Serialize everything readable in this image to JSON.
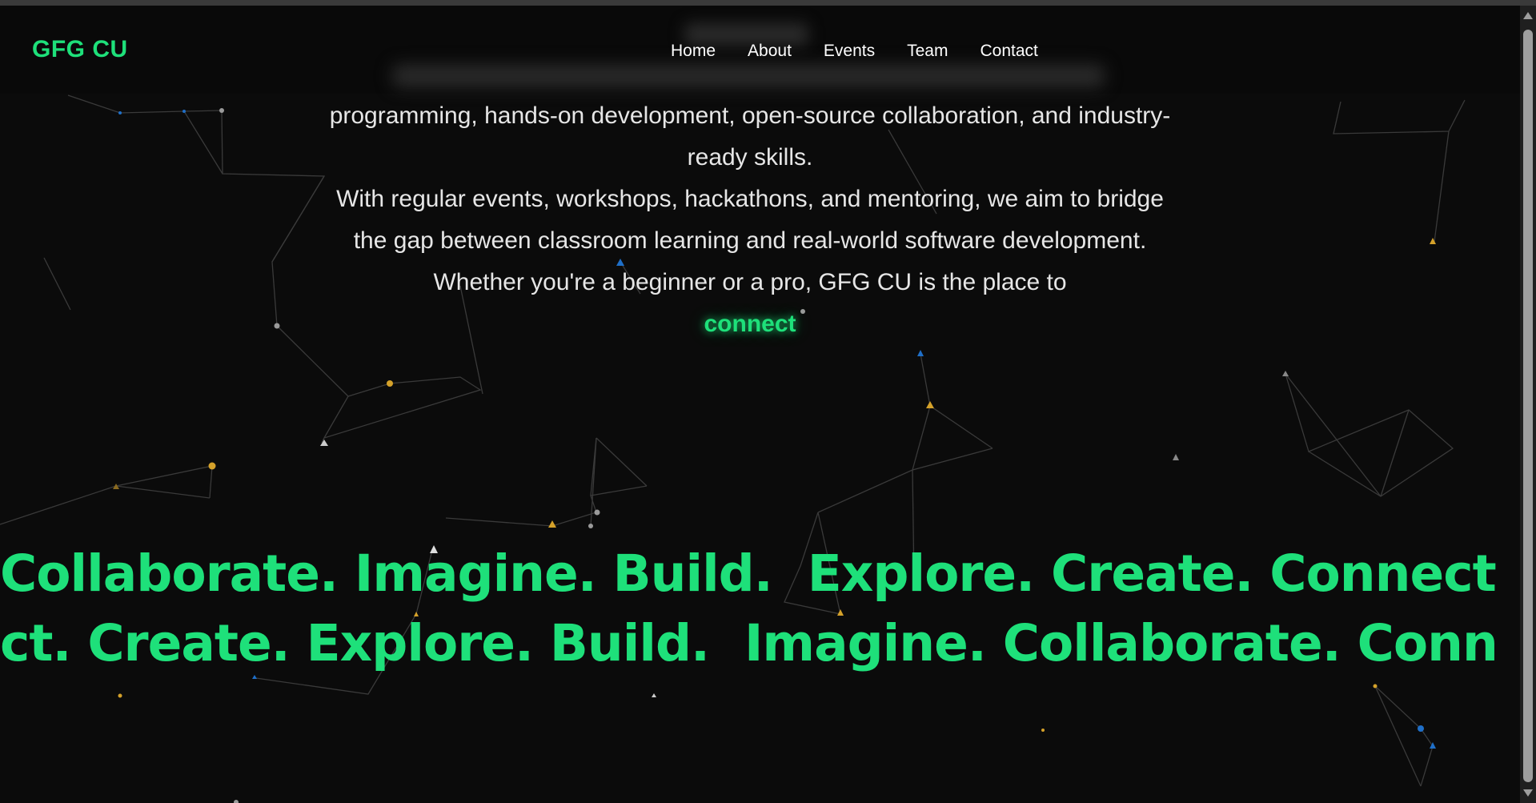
{
  "brand": {
    "name": "GFG CU"
  },
  "nav": {
    "items": [
      {
        "label": "Home"
      },
      {
        "label": "About"
      },
      {
        "label": "Events"
      },
      {
        "label": "Team"
      },
      {
        "label": "Contact"
      }
    ]
  },
  "intro": {
    "line1": "programming, hands-on development, open-source collaboration, and industry-ready skills.",
    "line2": "With regular events, workshops, hackathons, and mentoring, we aim to bridge the gap between classroom learning and real-world software development.",
    "line3_prefix": "Whether you're a beginner or a pro, GFG CU is the place to",
    "highlight_word": "connect"
  },
  "marquee": {
    "row1": [
      "Collaborate. Imagine. Build.",
      "Explore. Create. Connect. Collaborate."
    ],
    "row2": [
      "ct. Create. Explore. Build.",
      "Imagine. Collaborate. Connect. Create."
    ]
  },
  "colors": {
    "accent": "#1ee07a",
    "background": "#0b0b0b",
    "text": "#e6e6e6"
  }
}
